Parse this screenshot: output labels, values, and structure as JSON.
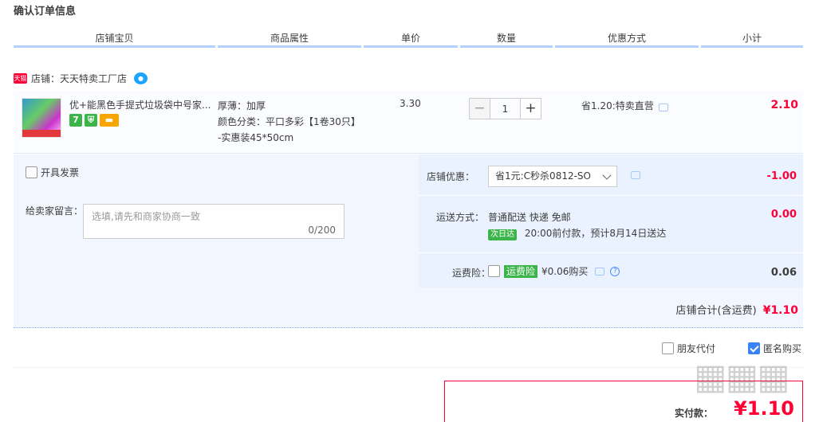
{
  "page_title": "确认订单信息",
  "columns": [
    "店铺宝贝",
    "商品属性",
    "单价",
    "数量",
    "优惠方式",
    "小计"
  ],
  "shop": {
    "tmall_badge": "天猫",
    "name": "店铺：天天特卖工厂店"
  },
  "item": {
    "title": "优+能黑色手提式垃圾袋中号家...",
    "badges": [
      "7",
      "shield-icon",
      "card-icon"
    ],
    "attr_thickness": "厚薄：加厚",
    "attr_color": "颜色分类：平口多彩【1卷30只】",
    "attr_size": "-实惠装45*50cm",
    "unit_price": "3.30",
    "quantity": "1",
    "discount": "省1.20:特卖直营",
    "subtotal": "2.10"
  },
  "order": {
    "invoice_label": "开具发票",
    "message_label": "给卖家留言：",
    "message_placeholder": "选填,请先和商家协商一致",
    "message_count": "0/200",
    "shop_discount_label": "店铺优惠：",
    "shop_discount_option": "省1元:C秒杀0812-SO",
    "shop_discount_amount": "-1.00",
    "shipping_label": "运送方式：",
    "shipping_method": "普通配送 快递 免邮",
    "next_day_badge": "次日达",
    "shipping_eta": "20:00前付款，预计8月14日送达",
    "shipping_amount": "0.00",
    "insurance_label": "运费险：",
    "insurance_tag": "运费险",
    "insurance_price": "¥0.06购买",
    "insurance_amount": "0.06",
    "total_label": "店铺合计(含运费)",
    "total_value": "¥1.10"
  },
  "options": {
    "friend_pay": "朋友代付",
    "anonymous": "匿名购买"
  },
  "payment": {
    "label": "实付款：",
    "value": "¥1.10"
  },
  "colors": {
    "accent_red": "#ff0036",
    "header_underline": "#b2d1ff",
    "panel_bg": "#f2f7ff",
    "green_badge": "#3bb54a"
  }
}
